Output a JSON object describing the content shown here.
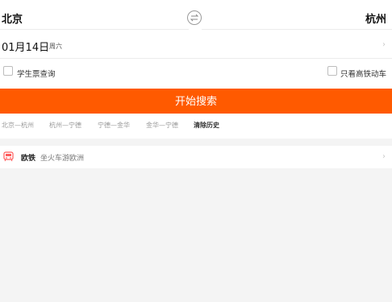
{
  "header": {
    "from_city": "北京",
    "to_city": "杭州"
  },
  "date": {
    "date_text": "01月14日",
    "weekday": "周六"
  },
  "options": {
    "student_ticket_label": "学生票查询",
    "high_speed_only_label": "只看高铁动车",
    "student_ticket_checked": false,
    "high_speed_only_checked": false
  },
  "search": {
    "button_label": "开始搜索"
  },
  "history": {
    "items": [
      "北京—杭州",
      "杭州—宁德",
      "宁德—金华",
      "金华—宁德"
    ],
    "clear_label": "清除历史"
  },
  "promo": {
    "title": "欧铁",
    "subtitle": "坐火车游欧洲"
  },
  "colors": {
    "accent": "#ff5a00",
    "banner_text": "#f5a000",
    "background": "#f4f4f4"
  },
  "icons": {
    "swap": "swap-arrows-icon",
    "chevron": "chevron-right-icon",
    "promo": "train-icon"
  }
}
